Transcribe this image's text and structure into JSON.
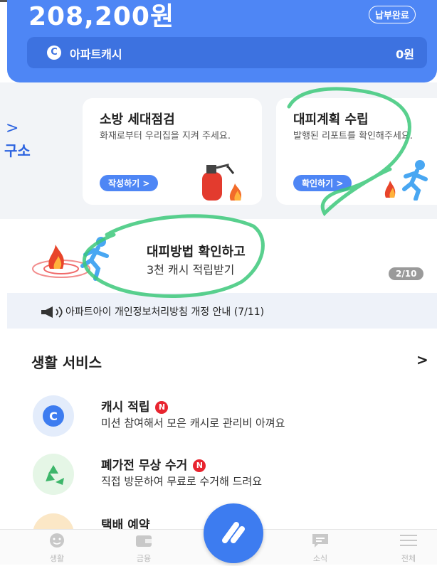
{
  "header": {
    "amount": "208,200원",
    "paid_badge": "납부완료",
    "cash_label": "아파트캐시",
    "cash_value": "0원"
  },
  "carousel": {
    "prev_label": "구소",
    "cards": [
      {
        "title": "소방 세대점검",
        "desc": "화재로부터 우리집을 지켜 주세요.",
        "button": "작성하기 >",
        "icon": "fire-extinguisher-icon"
      },
      {
        "title": "대피계획 수립",
        "desc": "발행된 리포트를 확인해주세요.",
        "button": "확인하기 >",
        "icon": "running-person-icon"
      }
    ]
  },
  "evac_banner": {
    "title": "대피방법 확인하고",
    "subtitle": "3천 캐시 적립받기",
    "pager": "2/10"
  },
  "notice": {
    "text": "아파트아이 개인정보처리방침 개정 안내 (7/11)"
  },
  "life_services": {
    "title": "생활 서비스",
    "arrow": ">",
    "items": [
      {
        "title": "캐시 적립",
        "badge": "N",
        "desc": "미션 참여해서 모은 캐시로 관리비 아껴요",
        "icon": "cash-coin-icon",
        "icon_bg": "#e3ecfb"
      },
      {
        "title": "폐가전 무상 수거",
        "badge": "N",
        "desc": "직접 방문하여 무료로 수거해 드려요",
        "icon": "recycle-icon",
        "icon_bg": "#e5f6e6"
      },
      {
        "title": "택배 예약",
        "icon": "parcel-box-icon",
        "icon_bg": "#fbe7c6"
      }
    ]
  },
  "bottom_nav": {
    "items": [
      {
        "label": "생활",
        "icon": "smile-icon"
      },
      {
        "label": "금융",
        "icon": "wallet-icon"
      },
      {
        "label": "소식",
        "icon": "message-icon"
      },
      {
        "label": "전체",
        "icon": "menu-icon"
      }
    ]
  },
  "colors": {
    "primary": "#4e86f5",
    "badge_red": "#e8242f",
    "scribble_green": "#3cc87a"
  }
}
